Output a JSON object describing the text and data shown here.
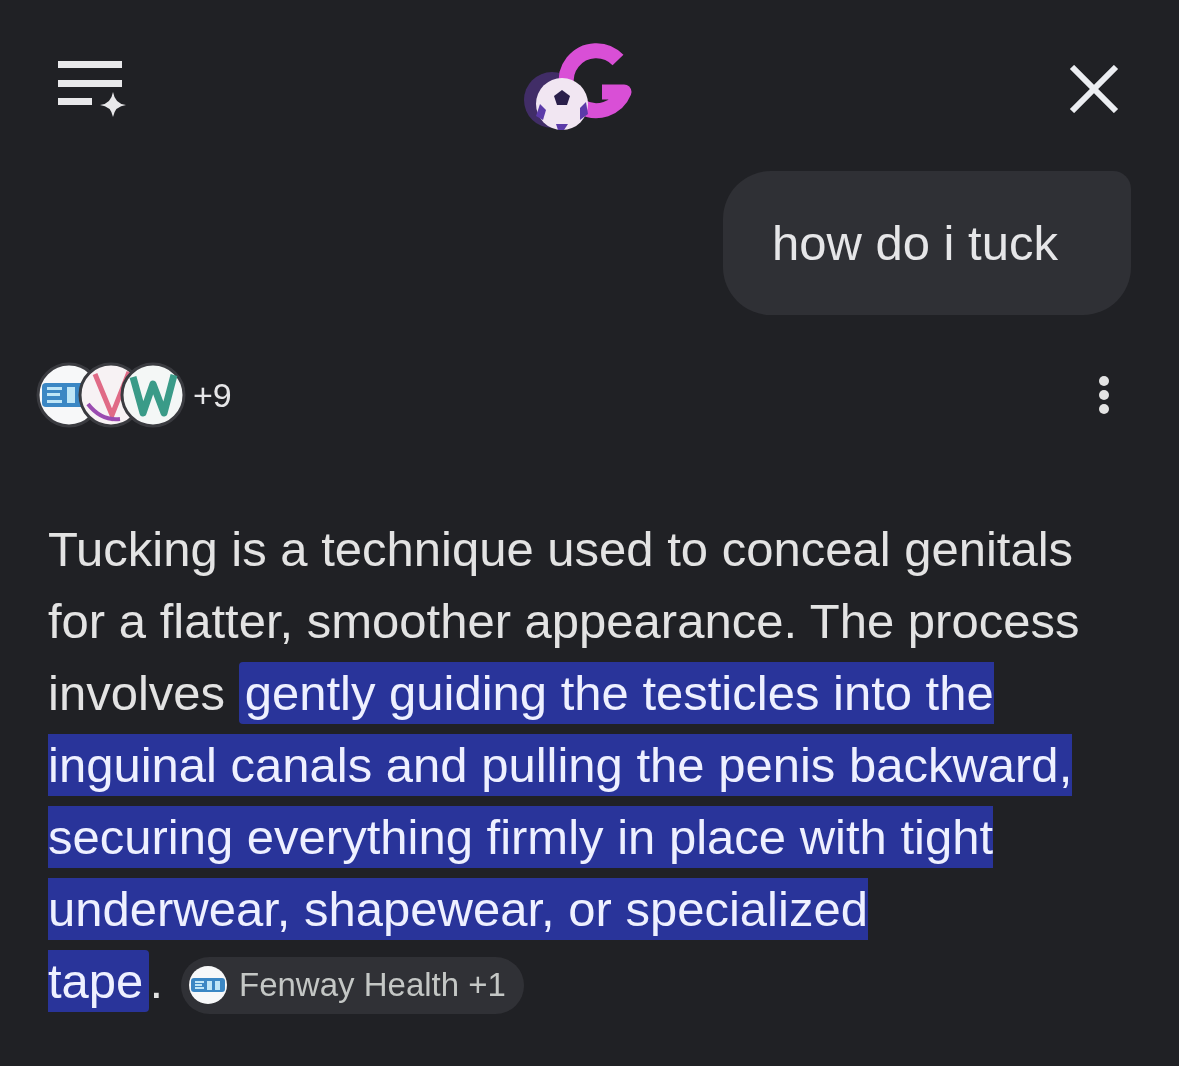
{
  "user_message": {
    "text": "how do i tuck"
  },
  "response": {
    "sources": {
      "more_count": "+9"
    },
    "answer": [
      {
        "text": "Tucking is a technique used to conceal genitals for a flatter, smoother appearance. The process involves ",
        "highlighted": false
      },
      {
        "text": "gently guiding the testicles into the inguinal canals and pulling the penis backward, securing everything firmly in place with tight underwear, shapewear, or specialized tape",
        "highlighted": true
      },
      {
        "text": ".",
        "highlighted": false
      }
    ],
    "citation": {
      "label": "Fenway Health +1"
    }
  }
}
